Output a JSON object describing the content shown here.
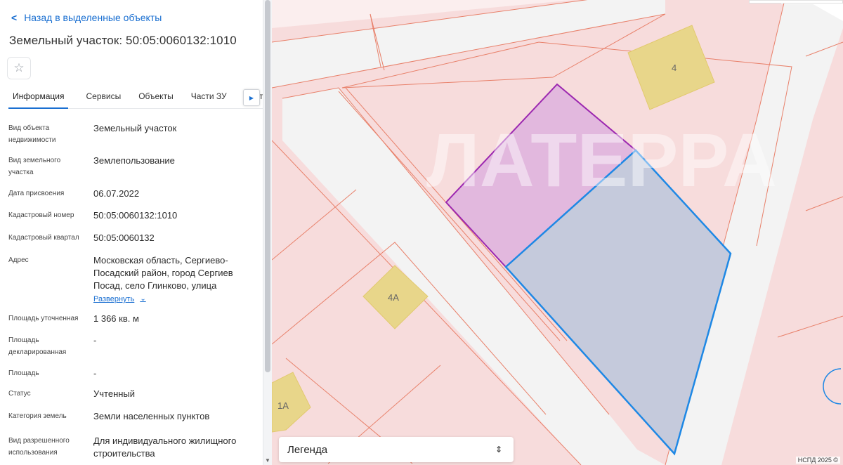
{
  "nav": {
    "back_label": "Назад в выделенные объекты"
  },
  "object": {
    "title": "Земельный участок: 50:05:0060132:1010"
  },
  "tabs": [
    {
      "label": "Информация"
    },
    {
      "label": "Сервисы"
    },
    {
      "label": "Объекты"
    },
    {
      "label": "Части ЗУ"
    },
    {
      "label": "Соста"
    }
  ],
  "properties": {
    "kind": {
      "label": "Вид объекта недвижимости",
      "value": "Земельный участок"
    },
    "land_type": {
      "label": "Вид земельного участка",
      "value": "Землепользование"
    },
    "assign_date": {
      "label": "Дата присвоения",
      "value": "06.07.2022"
    },
    "cad_number": {
      "label": "Кадастровый номер",
      "value": "50:05:0060132:1010"
    },
    "cad_quarter": {
      "label": "Кадастровый квартал",
      "value": "50:05:0060132"
    },
    "address": {
      "label": "Адрес",
      "value": "Московская область, Сергиево-Посадский район, город Сергиев Посад, село Глинково, улица",
      "expand": "Развернуть"
    },
    "area_refined": {
      "label": "Площадь уточненная",
      "value": "1 366 кв. м"
    },
    "area_declared": {
      "label": "Площадь декларированная",
      "value": "-"
    },
    "area": {
      "label": "Площадь",
      "value": "-"
    },
    "status": {
      "label": "Статус",
      "value": "Учтенный"
    },
    "category": {
      "label": "Категория земель",
      "value": "Земли населенных пунктов"
    },
    "permitted_use": {
      "label": "Вид разрешенного использования",
      "value": "Для индивидуального жилищного строительства"
    }
  },
  "map": {
    "buildings": [
      "4",
      "4А",
      "1А"
    ],
    "watermark": "ЛАТЕРРА",
    "legend_label": "Легенда",
    "attribution": "НСПД 2025 ©",
    "colors": {
      "selected_parcel": "#1e88e5",
      "highlight_parcel": "#9c27b0",
      "building": "#e8d68a",
      "parcel_fill": "#f7dcdc",
      "road": "#f2f2f2"
    }
  }
}
